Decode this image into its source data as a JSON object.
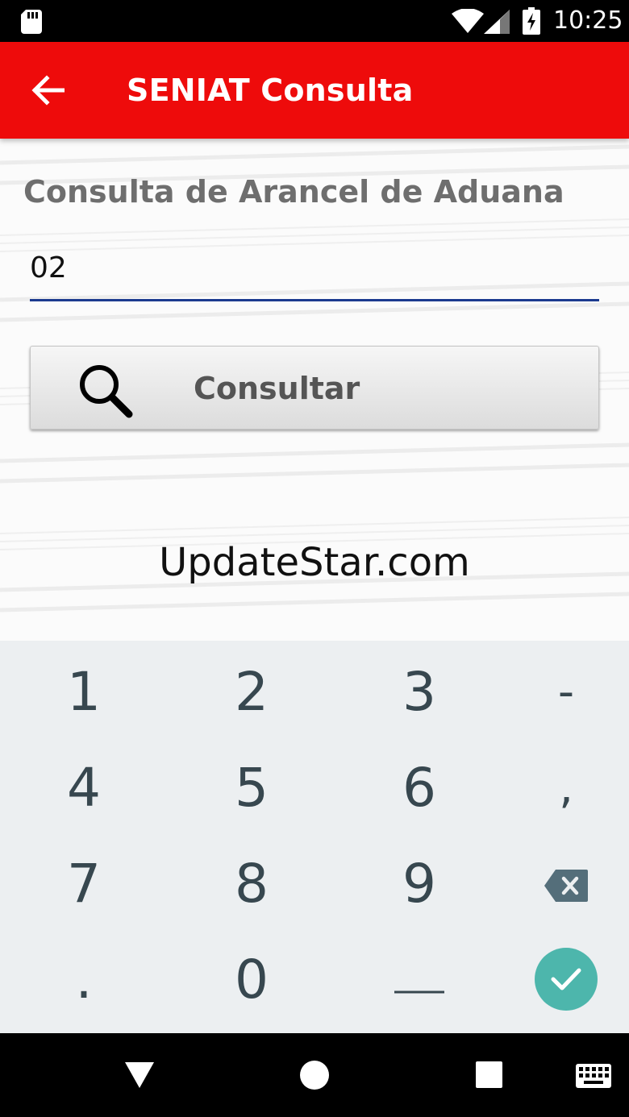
{
  "status": {
    "time": "10:25"
  },
  "app_bar": {
    "title": "SENIAT Consulta"
  },
  "main": {
    "heading": "Consulta de Arancel de Aduana",
    "query_value": "02",
    "consult_label": "Consultar",
    "brand_text": "UpdateStar.com"
  },
  "keypad": {
    "rows": [
      [
        "1",
        "2",
        "3",
        "-"
      ],
      [
        "4",
        "5",
        "6",
        ","
      ],
      [
        "7",
        "8",
        "9"
      ],
      [
        ".",
        "0"
      ]
    ]
  },
  "colors": {
    "app_bar": "#ee0b0b",
    "field_underline": "#1b3a8f",
    "enter_key": "#4db6ac",
    "keypad_bg": "#eceff1"
  },
  "icons": [
    "sd-card-icon",
    "wifi-icon",
    "signal-icon",
    "battery-charging-icon",
    "back-arrow-icon",
    "search-icon",
    "backspace-icon",
    "check-icon",
    "nav-back-icon",
    "nav-home-icon",
    "nav-recents-icon",
    "keyboard-icon"
  ]
}
